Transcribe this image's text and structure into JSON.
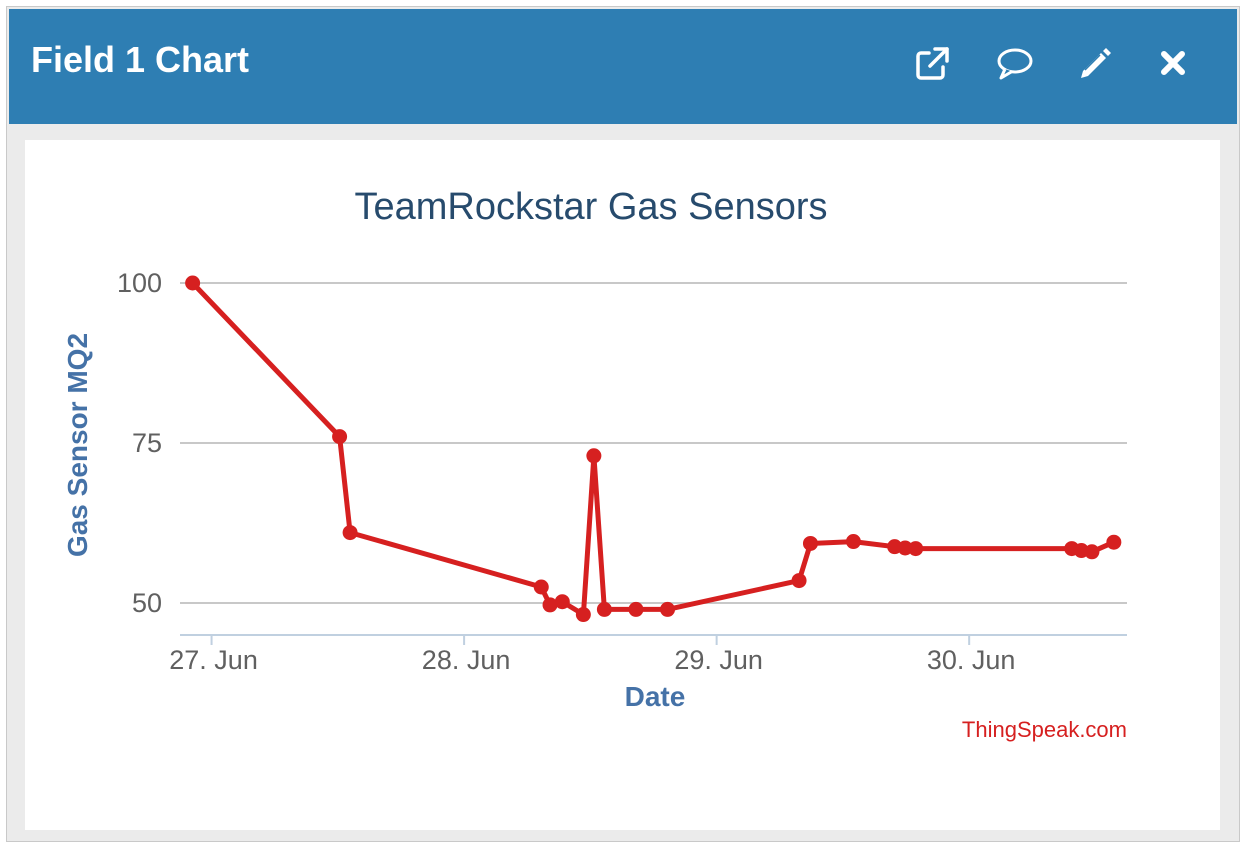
{
  "widget": {
    "title": "Field 1 Chart",
    "actions": [
      {
        "name": "open-external-icon"
      },
      {
        "name": "comment-icon"
      },
      {
        "name": "edit-icon"
      },
      {
        "name": "close-icon"
      }
    ]
  },
  "colors": {
    "header": "#2e7eb3",
    "series": "#d62020",
    "title": "#274b6d",
    "axis_title": "#4572a7",
    "credit": "#d62020"
  },
  "chart_data": {
    "type": "line",
    "title": "TeamRockstar Gas Sensors",
    "xlabel": "Date",
    "ylabel": "Gas Sensor MQ2",
    "credit": "ThingSpeak.com",
    "x_ticks": [
      "27. Jun",
      "28. Jun",
      "29. Jun",
      "30. Jun"
    ],
    "y_ticks": [
      100,
      75,
      50
    ],
    "xlim": [
      "2017-06-26T21:00",
      "2017-06-30T15:00"
    ],
    "ylim": [
      45,
      100
    ],
    "grid": true,
    "series": [
      {
        "points": [
          {
            "x": "2017-06-26T22:12",
            "y": 100
          },
          {
            "x": "2017-06-27T12:10",
            "y": 76
          },
          {
            "x": "2017-06-27T13:10",
            "y": 61
          },
          {
            "x": "2017-06-28T07:20",
            "y": 52.5
          },
          {
            "x": "2017-06-28T08:10",
            "y": 49.7
          },
          {
            "x": "2017-06-28T09:20",
            "y": 50.2
          },
          {
            "x": "2017-06-28T11:20",
            "y": 48.2
          },
          {
            "x": "2017-06-28T12:20",
            "y": 73
          },
          {
            "x": "2017-06-28T13:20",
            "y": 49
          },
          {
            "x": "2017-06-28T16:20",
            "y": 49
          },
          {
            "x": "2017-06-28T19:20",
            "y": 49
          },
          {
            "x": "2017-06-29T07:50",
            "y": 53.5
          },
          {
            "x": "2017-06-29T08:55",
            "y": 59.3
          },
          {
            "x": "2017-06-29T13:00",
            "y": 59.6
          },
          {
            "x": "2017-06-29T16:55",
            "y": 58.8
          },
          {
            "x": "2017-06-29T17:55",
            "y": 58.6
          },
          {
            "x": "2017-06-29T18:55",
            "y": 58.5
          },
          {
            "x": "2017-06-30T09:45",
            "y": 58.5
          },
          {
            "x": "2017-06-30T10:40",
            "y": 58.2
          },
          {
            "x": "2017-06-30T11:40",
            "y": 58
          },
          {
            "x": "2017-06-30T13:45",
            "y": 59.5
          }
        ]
      }
    ]
  }
}
